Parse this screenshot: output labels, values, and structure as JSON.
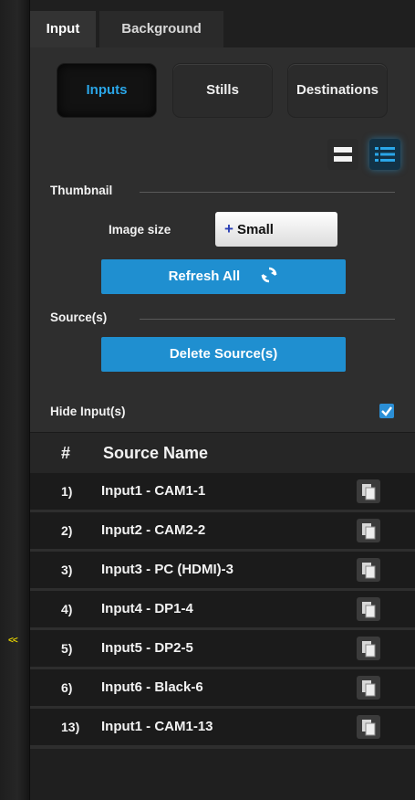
{
  "sidebar": {
    "collapse_label": "<<"
  },
  "tabs": [
    {
      "label": "Input",
      "active": true
    },
    {
      "label": "Background",
      "active": false
    }
  ],
  "segments": [
    {
      "label": "Inputs",
      "active": true
    },
    {
      "label": "Stills",
      "active": false
    },
    {
      "label": "Destinations",
      "active": false
    }
  ],
  "view_toggle": {
    "grid_icon": "grid-view-icon",
    "list_icon": "list-view-icon",
    "active": "list"
  },
  "thumbnail": {
    "section_title": "Thumbnail",
    "image_size_label": "Image size",
    "image_size_value": "Small",
    "image_size_prefix": "+",
    "refresh_label": "Refresh All",
    "refresh_icon": "refresh-icon"
  },
  "sources": {
    "section_title": "Source(s)",
    "delete_label": "Delete Source(s)"
  },
  "hide_inputs": {
    "label": "Hide Input(s)",
    "checked": true
  },
  "table": {
    "columns": [
      "#",
      "Source Name"
    ],
    "rows": [
      {
        "num": "1)",
        "name": "Input1 - CAM1-1"
      },
      {
        "num": "2)",
        "name": "Input2 - CAM2-2"
      },
      {
        "num": "3)",
        "name": "Input3 - PC (HDMI)-3"
      },
      {
        "num": "4)",
        "name": "Input4 - DP1-4"
      },
      {
        "num": "5)",
        "name": "Input5 - DP2-5"
      },
      {
        "num": "6)",
        "name": "Input6 - Black-6"
      },
      {
        "num": "13)",
        "name": "Input1 - CAM1-13"
      }
    ]
  },
  "colors": {
    "accent": "#1f8fd0",
    "active_text": "#2aa6e8",
    "collapse_arrow": "#e8d400",
    "panel": "#2e2e2e",
    "row": "#1b1b1b"
  }
}
